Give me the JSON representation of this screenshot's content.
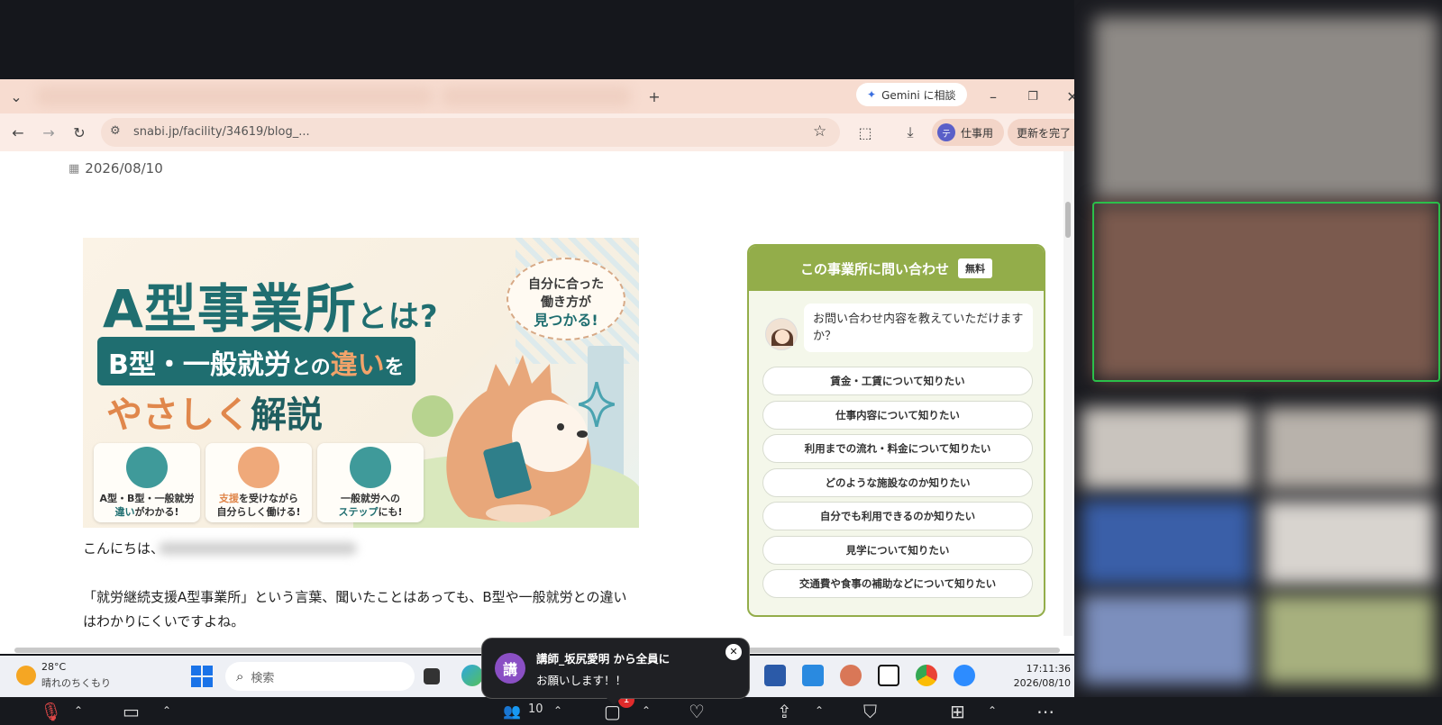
{
  "browser": {
    "gemini_label": "Gemini に相談",
    "url": "snabi.jp/facility/34619/blog_...",
    "profile_label": "仕事用",
    "profile_initial": "テ",
    "update_label": "更新を完了"
  },
  "page": {
    "date": "2026/08/10",
    "banner": {
      "title_main": "A型事業所",
      "title_small": "とは?",
      "sub_a": "B型・一般就労",
      "sub_b": "との",
      "sub_c": "違い",
      "sub_d": "を",
      "third_a": "やさしく",
      "third_b": "解説",
      "bubble_1": "自分に合った",
      "bubble_2": "働き方が",
      "bubble_3": "見つかる!",
      "card1_line1": "A型・B型・一般就労",
      "card1_line2a": "違い",
      "card1_line2b": "がわかる!",
      "card2_line1a": "支援",
      "card2_line1b": "を受けながら",
      "card2_line2": "自分らしく働ける!",
      "card3_line1": "一般就労への",
      "card3_line2a": "ステップ",
      "card3_line2b": "にも!"
    },
    "greeting": "こんにちは、",
    "paragraph_line1": "「就労継続支援A型事業所」という言葉、聞いたことはあっても、B型や一般就労との違い",
    "paragraph_line2": "はわかりにくいですよね。"
  },
  "inquiry": {
    "title": "この事業所に問い合わせ",
    "free_badge": "無料",
    "prompt": "お問い合わせ内容を教えていただけますか？",
    "options": [
      "賃金・工賃について知りたい",
      "仕事内容について知りたい",
      "利用までの流れ・料金について知りたい",
      "どのような施設なのか知りたい",
      "自分でも利用できるのか知りたい",
      "見学について知りたい",
      "交通費や食事の補助などについて知りたい"
    ]
  },
  "taskbar": {
    "weather_temp": "28°C",
    "weather_desc": "晴れのちくもり",
    "search_placeholder": "検索",
    "time": "17:11:36",
    "date": "2026/08/10"
  },
  "chat_toast": {
    "avatar_char": "講",
    "sender": "講師_坂尻愛明 から全員に",
    "message": "お願いします！！"
  },
  "zoom": {
    "participants_count": "10",
    "chat_badge": "1"
  },
  "colors": {
    "accent_green": "#93ad4a",
    "banner_teal": "#1f6e70",
    "banner_orange": "#e0874c"
  }
}
